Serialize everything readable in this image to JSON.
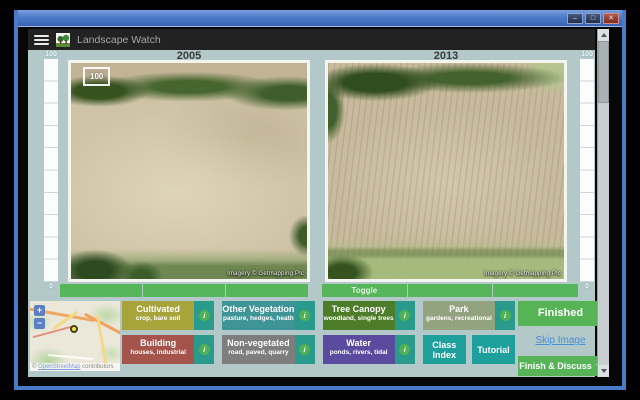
{
  "window": {
    "controls": {
      "minimize": "–",
      "maximize": "□",
      "close": "✕"
    }
  },
  "header": {
    "app_title": "Landscape Watch"
  },
  "panels": {
    "left": {
      "year": "2005",
      "badge": "100",
      "credit": "Imagery © Getmapping Plc"
    },
    "right": {
      "year": "2013",
      "credit": "Imagery © Getmapping Plc"
    },
    "toggle_label": "Toggle",
    "scale": {
      "max": "100",
      "min": "0"
    }
  },
  "minimap": {
    "zoom_in": "+",
    "zoom_out": "−",
    "attribution": {
      "prefix": "© ",
      "link": "OpenStreetMap",
      "suffix": " contributors",
      "link_color": "#7d9bd9"
    }
  },
  "classes": {
    "info_icon": "i",
    "info_bg": "#2a9a8c",
    "info_circle_bg": "#4fb054",
    "accent_teal": "#1d9f9b",
    "row1": [
      {
        "label": "Cultivated",
        "sub": "crop, bare soil",
        "color": "#a8a43c"
      },
      {
        "label": "Other Vegetation",
        "sub": "pasture, hedges, heath",
        "color": "#3f9496"
      },
      {
        "label": "Tree Canopy",
        "sub": "woodland, single trees",
        "color": "#4d7d28"
      },
      {
        "label": "Park",
        "sub": "gardens, recreational",
        "color": "#94a37f"
      }
    ],
    "row2": [
      {
        "label": "Building",
        "sub": "houses, industrial",
        "color": "#a5544c"
      },
      {
        "label": "Non-vegetated",
        "sub": "road, paved, quarry",
        "color": "#7e7e7e"
      },
      {
        "label": "Water",
        "sub": "ponds, rivers, tidal",
        "color": "#5b4b9e"
      }
    ],
    "class_index": "Class Index",
    "tutorial": "Tutorial"
  },
  "actions": {
    "finished": "Finished",
    "skip_image": "Skip Image",
    "finish_discuss": "Finish & Discuss",
    "green": "#56b457",
    "link_blue": "#4a90d2"
  }
}
